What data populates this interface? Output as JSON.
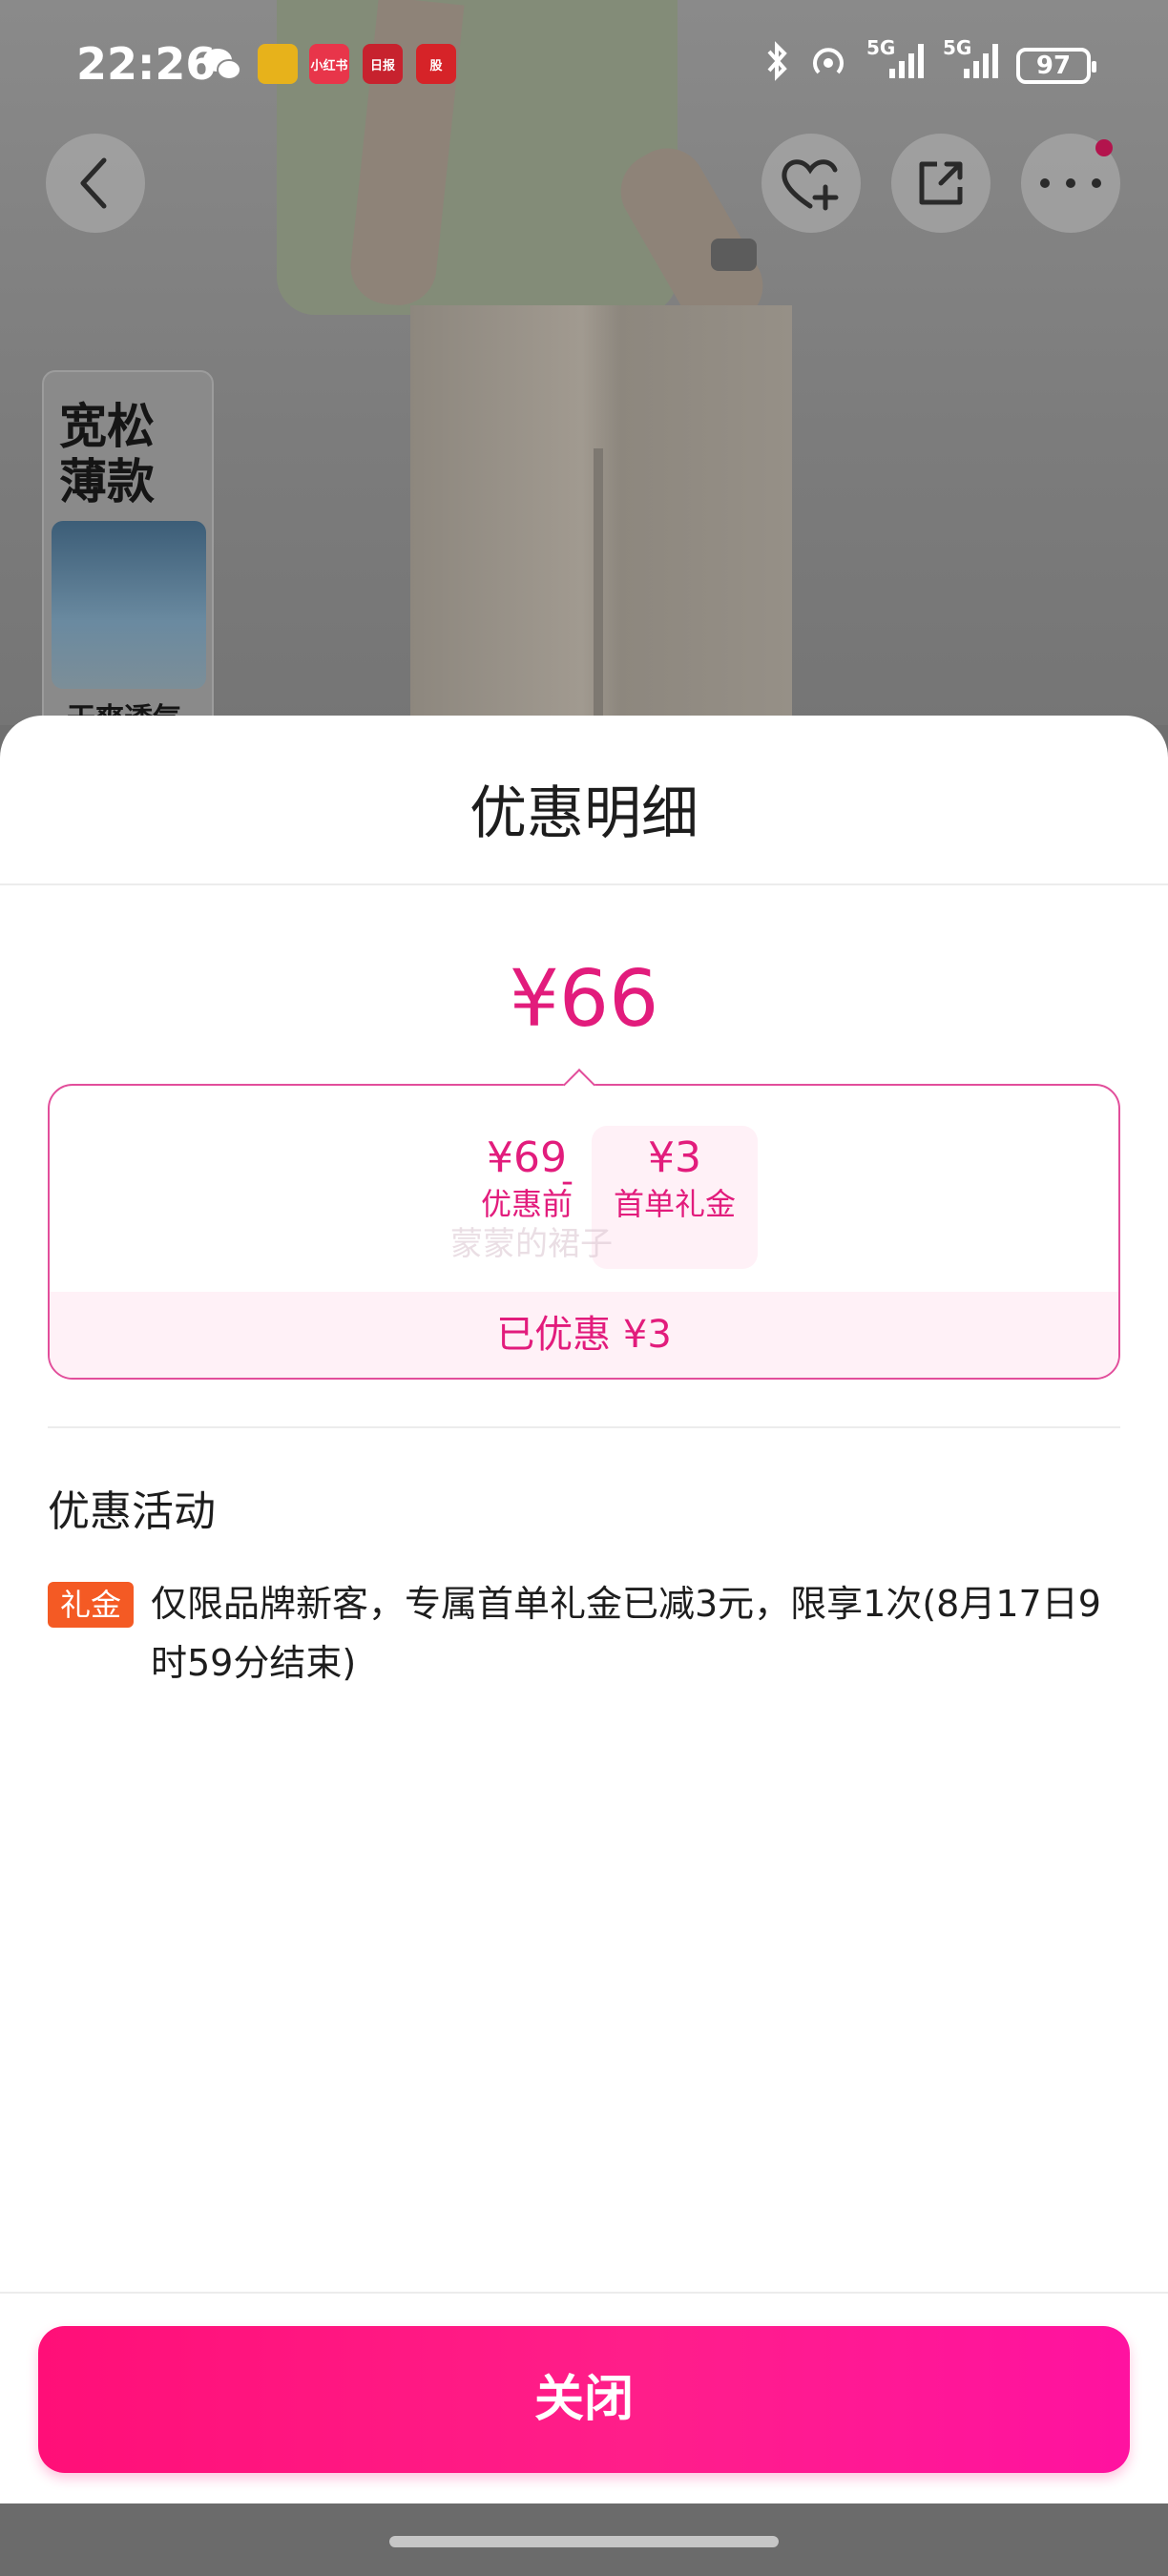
{
  "status_bar": {
    "time": "22:26",
    "app_icons": [
      {
        "name": "wechat-icon",
        "text": ""
      },
      {
        "name": "honeycomb-app-icon",
        "text": ""
      },
      {
        "name": "xiaohongshu-icon",
        "text": "小红书"
      },
      {
        "name": "news-app-icon",
        "text": "日报"
      },
      {
        "name": "stock-app-icon",
        "text": "股"
      }
    ],
    "signal_1": "5G",
    "signal_2": "5G",
    "battery": "97"
  },
  "product_page": {
    "promo_tag_title": "宽松\n薄款",
    "promo_tag_footer": "干爽透气"
  },
  "sheet": {
    "title": "优惠明细",
    "final_price": "¥66",
    "calc": {
      "original_value": "¥69",
      "original_label": "优惠前",
      "minus": "-",
      "gift_value": "¥3",
      "gift_label": "首单礼金",
      "watermark": "蒙蒙的裙子",
      "saved": "已优惠 ¥3"
    },
    "section_title": "优惠活动",
    "promotion": {
      "badge": "礼金",
      "text": "仅限品牌新客，专属首单礼金已减3元，限享1次(8月17日9时59分结束)"
    },
    "close_button": "关闭"
  },
  "colors": {
    "accent": "#e21c7c",
    "button_start": "#ff0f78",
    "button_end": "#ff12a0",
    "badge": "#f45a24"
  }
}
